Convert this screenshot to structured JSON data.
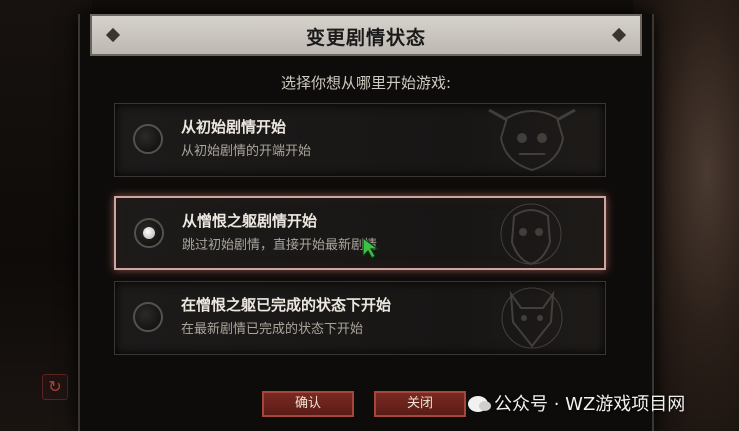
{
  "dialog": {
    "title": "变更剧情状态",
    "prompt": "选择你想从哪里开始游戏:",
    "options": [
      {
        "title": "从初始剧情开始",
        "description": "从初始剧情的开端开始",
        "selected": false,
        "art_icon": "demon-skull-icon"
      },
      {
        "title": "从憎恨之躯剧情开始",
        "description": "跳过初始剧情，直接开始最新剧情",
        "selected": true,
        "art_icon": "horned-mask-icon"
      },
      {
        "title": "在憎恨之躯已完成的状态下开始",
        "description": "在最新剧情已完成的状态下开始",
        "selected": false,
        "art_icon": "wolf-head-icon"
      }
    ],
    "confirm_label": "确认",
    "close_label": "关闭"
  },
  "watermark": {
    "text": "公众号 · WZ游戏项目网",
    "icon": "wechat-icon"
  },
  "colors": {
    "accent_button": "#6a2219",
    "selected_border": "#c8a8a0",
    "title_bar": "#c8c3bc"
  }
}
